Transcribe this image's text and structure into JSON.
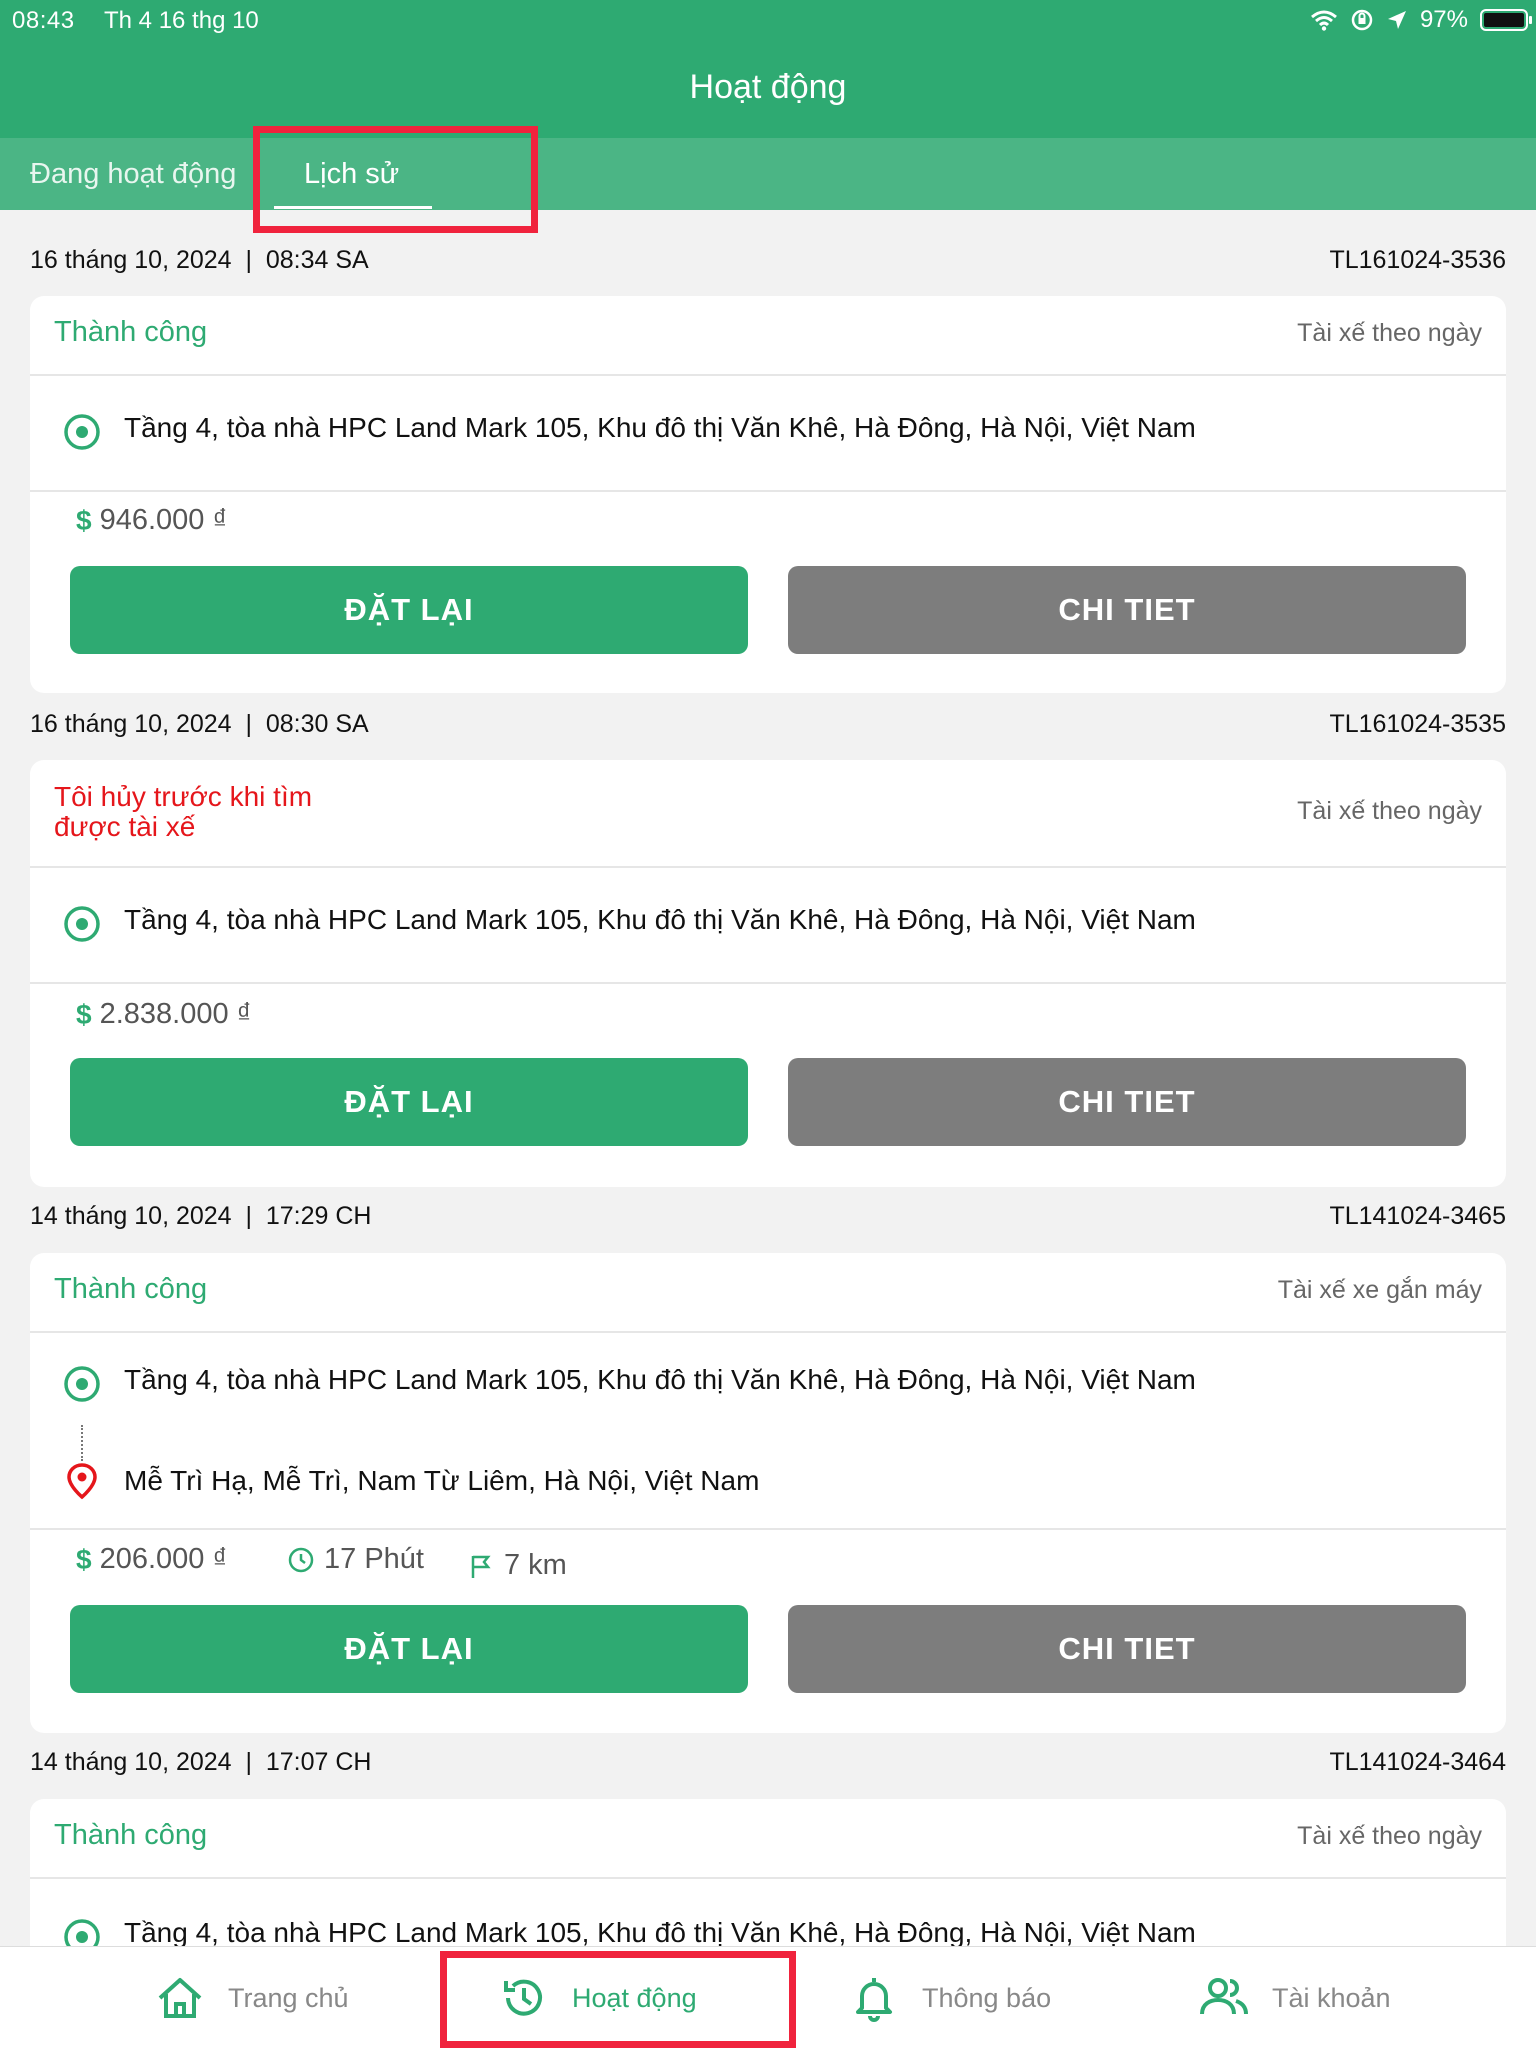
{
  "status_bar": {
    "time": "08:43",
    "date": "Th 4 16 thg 10",
    "battery": "97%"
  },
  "header": {
    "title": "Hoạt động"
  },
  "tabs": [
    {
      "label": "Đang hoạt động"
    },
    {
      "label": "Lịch sử",
      "active": true
    }
  ],
  "orders": [
    {
      "datetime": "16 tháng 10, 2024  |  08:34 SA",
      "code": "TL161024-3536",
      "status": "Thành công",
      "service": "Tài xế theo ngày",
      "pickup": "Tầng 4, tòa nhà HPC Land Mark 105, Khu đô thị Văn Khê, Hà Đông, Hà Nội, Việt Nam",
      "price": "946.000 ₫",
      "reorder": "ĐẶT LẠI",
      "detail": "CHI TIET"
    },
    {
      "datetime": "16 tháng 10, 2024  |  08:30 SA",
      "code": "TL161024-3535",
      "status": "Tôi hủy trước khi tìm được tài xế",
      "service": "Tài xế theo ngày",
      "pickup": "Tầng 4, tòa nhà HPC Land Mark 105, Khu đô thị Văn Khê, Hà Đông, Hà Nội, Việt Nam",
      "price": "2.838.000 ₫",
      "reorder": "ĐẶT LẠI",
      "detail": "CHI TIET"
    },
    {
      "datetime": "14 tháng 10, 2024  |  17:29 CH",
      "code": "TL141024-3465",
      "status": "Thành công",
      "service": "Tài xế xe gắn máy",
      "pickup": "Tầng 4, tòa nhà HPC Land Mark 105, Khu đô thị Văn Khê, Hà Đông, Hà Nội, Việt Nam",
      "dropoff": "Mễ Trì Hạ, Mễ Trì, Nam Từ Liêm, Hà Nội, Việt Nam",
      "price": "206.000 ₫",
      "duration": "17 Phút",
      "distance": "7 km",
      "reorder": "ĐẶT LẠI",
      "detail": "CHI TIET"
    },
    {
      "datetime": "14 tháng 10, 2024  |  17:07 CH",
      "code": "TL141024-3464",
      "status": "Thành công",
      "service": "Tài xế theo ngày",
      "pickup": "Tầng 4, tòa nhà HPC Land Mark 105, Khu đô thị Văn Khê, Hà Đông, Hà Nội, Việt Nam"
    }
  ],
  "bottom_nav": [
    {
      "label": "Trang chủ",
      "icon": "home-icon"
    },
    {
      "label": "Hoạt động",
      "icon": "history-icon",
      "active": true
    },
    {
      "label": "Thông báo",
      "icon": "bell-icon"
    },
    {
      "label": "Tài khoản",
      "icon": "users-icon"
    }
  ],
  "colors": {
    "primary": "#2eaa72",
    "tab_bar": "#4bb585",
    "cancel": "#e5161b",
    "detail_button": "#7d7d7d",
    "highlight": "#f0233d"
  }
}
